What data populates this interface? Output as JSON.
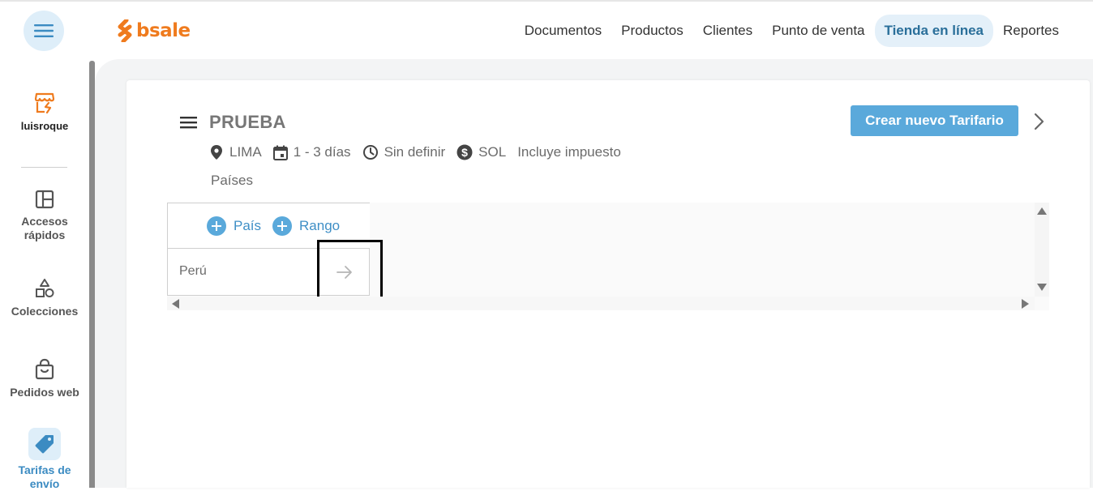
{
  "header": {
    "logo_text": "bsale",
    "brand_color": "#ef7b1e",
    "nav": [
      {
        "label": "Documentos",
        "active": false
      },
      {
        "label": "Productos",
        "active": false
      },
      {
        "label": "Clientes",
        "active": false
      },
      {
        "label": "Punto de venta",
        "active": false
      },
      {
        "label": "Tienda en línea",
        "active": true
      },
      {
        "label": "Reportes",
        "active": false
      }
    ]
  },
  "sidebar": {
    "store_name": "luisroque",
    "items": [
      {
        "label": "Accesos rápidos",
        "icon": "layout-icon"
      },
      {
        "label": "Colecciones",
        "icon": "shapes-icon"
      },
      {
        "label": "Pedidos web",
        "icon": "shopping-bag-icon"
      },
      {
        "label": "Tarifas de envío",
        "icon": "tag-icon",
        "active": true
      }
    ]
  },
  "main": {
    "title": "PRUEBA",
    "create_button": "Crear nuevo Tarifario",
    "meta": {
      "location": "LIMA",
      "days": "1 - 3 días",
      "schedule": "Sin definir",
      "currency": "SOL",
      "tax": "Incluye impuesto"
    },
    "section_label": "Países",
    "table": {
      "add_country": "País",
      "add_range": "Rango",
      "rows": [
        {
          "name": "Perú"
        }
      ]
    }
  },
  "colors": {
    "accent": "#5aa9db",
    "active_nav_bg": "#e4f0f9"
  }
}
